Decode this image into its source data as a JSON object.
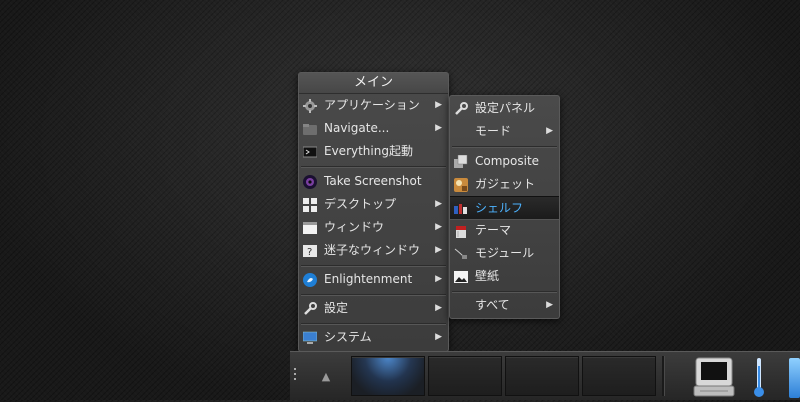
{
  "main_menu": {
    "title": "メイン",
    "items": [
      {
        "label": "アプリケーション",
        "icon": "gear-icon",
        "has_submenu": true
      },
      {
        "label": "Navigate...",
        "icon": "folder-icon",
        "has_submenu": true
      },
      {
        "label": "Everything起動",
        "icon": "terminal-icon",
        "has_submenu": false
      },
      {
        "label": "Take Screenshot",
        "icon": "camera-lens-icon",
        "has_submenu": false
      },
      {
        "label": "デスクトップ",
        "icon": "windows-grid-icon",
        "has_submenu": true
      },
      {
        "label": "ウィンドウ",
        "icon": "window-icon",
        "has_submenu": true
      },
      {
        "label": "迷子なウィンドウ",
        "icon": "question-window-icon",
        "has_submenu": true
      },
      {
        "label": "Enlightenment",
        "icon": "enlightenment-logo-icon",
        "has_submenu": true
      },
      {
        "label": "設定",
        "icon": "wrench-icon",
        "has_submenu": true
      },
      {
        "label": "システム",
        "icon": "computer-icon",
        "has_submenu": true
      }
    ]
  },
  "settings_submenu": {
    "items": [
      {
        "label": "設定パネル",
        "icon": "wrench-icon",
        "has_submenu": false
      },
      {
        "label": "モード",
        "icon": "",
        "has_submenu": true
      },
      {
        "label": "Composite",
        "icon": "composite-icon",
        "has_submenu": false
      },
      {
        "label": "ガジェット",
        "icon": "gadget-icon",
        "has_submenu": false
      },
      {
        "label": "シェルフ",
        "icon": "shelf-icon",
        "has_submenu": false,
        "selected": true
      },
      {
        "label": "テーマ",
        "icon": "paint-bucket-icon",
        "has_submenu": false
      },
      {
        "label": "モジュール",
        "icon": "plug-icon",
        "has_submenu": false
      },
      {
        "label": "壁紙",
        "icon": "wallpaper-icon",
        "has_submenu": false
      },
      {
        "label": "すべて",
        "icon": "",
        "has_submenu": true
      }
    ]
  },
  "arrow_glyph": "▶",
  "shelf": {
    "toggle_glyph": "▲",
    "desks": 4,
    "active_desk": 1,
    "icons": [
      "monitor-icon",
      "thermometer-icon",
      "battery-icon"
    ]
  },
  "colors": {
    "selected_text": "#4db3ff",
    "active_desk_glow": "#4f8fe0"
  }
}
